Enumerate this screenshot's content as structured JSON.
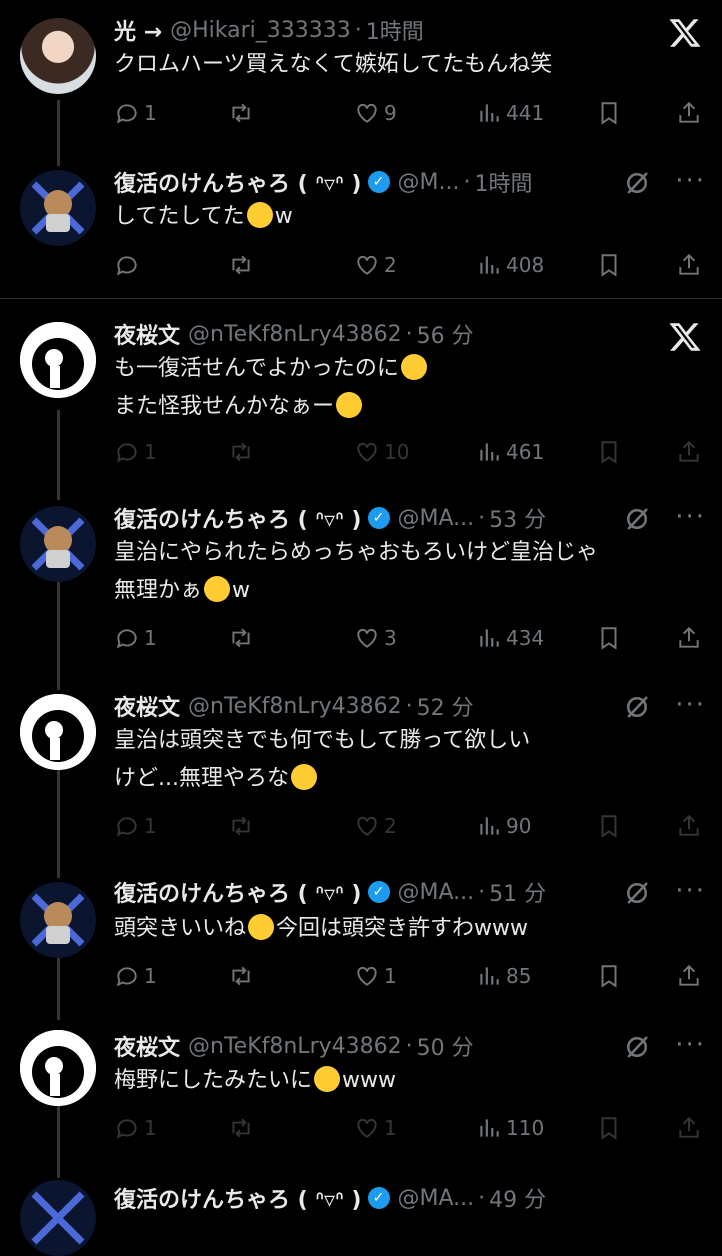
{
  "tweets": [
    {
      "name": "光 →",
      "handle": "@Hikari_333333",
      "time": "1時間",
      "text": [
        "クロムハーツ買えなくて嫉妬してたもんね笑"
      ],
      "replies": "1",
      "retweets": "",
      "likes": "9",
      "views": "441",
      "dim": false
    },
    {
      "name": "復活のけんちゃろ ( ᐢ▿ᐢ )",
      "handle": "@M...",
      "time": "1時間",
      "text": [
        "してたしてた",
        "w"
      ],
      "replies": "",
      "retweets": "",
      "likes": "2",
      "views": "408",
      "dim": false
    },
    {
      "name": "夜桜文",
      "handle": "@nTeKf8nLry43862",
      "time": "56 分",
      "text": [
        "も一復活せんでよかったのに",
        "また怪我せんかなぁー"
      ],
      "replies": "1",
      "retweets": "",
      "likes": "10",
      "views": "461",
      "dim": true
    },
    {
      "name": "復活のけんちゃろ ( ᐢ▿ᐢ )",
      "handle": "@MA...",
      "time": "53 分",
      "text": [
        "皇治にやられたらめっちゃおもろいけど皇治じゃ",
        "無理かぁ",
        "w"
      ],
      "replies": "1",
      "retweets": "",
      "likes": "3",
      "views": "434",
      "dim": false
    },
    {
      "name": "夜桜文",
      "handle": "@nTeKf8nLry43862",
      "time": "52 分",
      "text": [
        "皇治は頭突きでも何でもして勝って欲しい",
        "けど...無理やろな"
      ],
      "replies": "1",
      "retweets": "",
      "likes": "2",
      "views": "90",
      "dim": true
    },
    {
      "name": "復活のけんちゃろ ( ᐢ▿ᐢ )",
      "handle": "@MA...",
      "time": "51 分",
      "text": [
        "頭突きいいね",
        "今回は頭突き許すわwww"
      ],
      "replies": "1",
      "retweets": "",
      "likes": "1",
      "views": "85",
      "dim": false
    },
    {
      "name": "夜桜文",
      "handle": "@nTeKf8nLry43862",
      "time": "50 分",
      "text": [
        "梅野にしたみたいに",
        "www"
      ],
      "replies": "1",
      "retweets": "",
      "likes": "1",
      "views": "110",
      "dim": true
    },
    {
      "name": "復活のけんちゃろ ( ᐢ▿ᐢ )",
      "handle": "@MA...",
      "time": "49 分",
      "text": [],
      "replies": "",
      "retweets": "",
      "likes": "",
      "views": "",
      "dim": false
    }
  ],
  "icons": {
    "x_logo": "x-logo-icon",
    "grok": "grok-icon",
    "more": "more-icon",
    "reply": "reply-icon",
    "retweet": "retweet-icon",
    "like": "like-icon",
    "views": "views-icon",
    "bookmark": "bookmark-icon",
    "share": "share-icon"
  },
  "colors": {
    "bg": "#000000",
    "text": "#e7e9ea",
    "muted": "#71767b",
    "verified": "#1d9bf0"
  }
}
